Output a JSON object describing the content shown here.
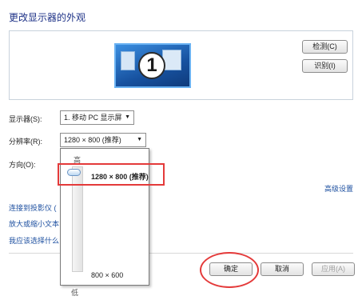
{
  "page_title": "更改显示器的外观",
  "preview": {
    "monitor_number": "1",
    "detect_button": "检测(C)",
    "identify_button": "识别(I)"
  },
  "display": {
    "label": "显示器(S):",
    "value": "1. 移动 PC 显示屏"
  },
  "resolution": {
    "label": "分辨率(R):",
    "value": "1280 × 800 (推荐)",
    "dropdown": {
      "high_label": "高",
      "low_label": "低",
      "top_option": "1280 × 800 (推荐)",
      "bottom_option": "800 × 600",
      "slider_level": 1.0
    }
  },
  "orientation": {
    "label": "方向(O):"
  },
  "advanced_link": "高级设置",
  "links": [
    "连接到投影仪 (",
    "放大或缩小文本",
    "我应该选择什么"
  ],
  "footer": {
    "ok_button": "确定",
    "cancel_button": "取消",
    "apply_button": "应用(A)"
  },
  "colors": {
    "title_blue": "#1e3287",
    "link_blue": "#1e50a0",
    "highlight_red": "#e43a3a",
    "monitor_blue": "#1c60a8"
  }
}
